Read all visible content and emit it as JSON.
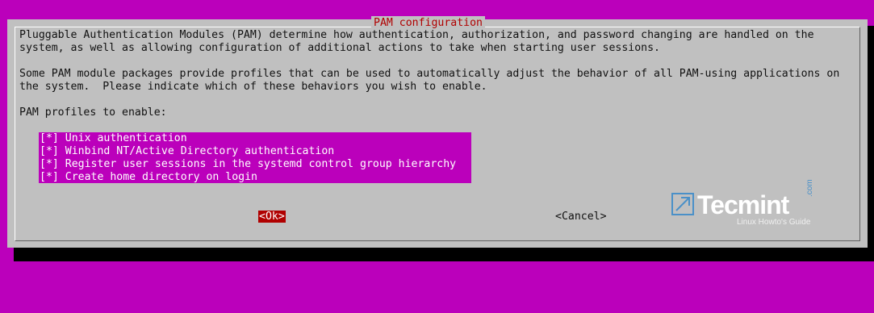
{
  "dialog": {
    "title": "PAM configuration",
    "description": [
      "Pluggable Authentication Modules (PAM) determine how authentication, authorization, and password changing are handled on the",
      "system, as well as allowing configuration of additional actions to take when starting user sessions.",
      "",
      "Some PAM module packages provide profiles that can be used to automatically adjust the behavior of all PAM-using applications on",
      "the system.  Please indicate which of these behaviors you wish to enable.",
      "",
      "PAM profiles to enable:"
    ],
    "profiles": [
      {
        "mark": "[*]",
        "label": "Unix authentication"
      },
      {
        "mark": "[*]",
        "label": "Winbind NT/Active Directory authentication"
      },
      {
        "mark": "[*]",
        "label": "Register user sessions in the systemd control group hierarchy"
      },
      {
        "mark": "[*]",
        "label": "Create home directory on login"
      }
    ],
    "buttons": {
      "ok_label": "<Ok>",
      "cancel_label": "<Cancel>"
    }
  },
  "watermark": {
    "brand": "Tecmint",
    "tld": ".com",
    "tagline": "Linux Howto's Guide",
    "icon": "tecmint-logo-icon"
  },
  "colors": {
    "background": "#bb00bb",
    "dialog": "#c0c0c0",
    "title_text": "#b00000",
    "selected_button": "#b00000",
    "brand_blue": "#4a90c8"
  }
}
